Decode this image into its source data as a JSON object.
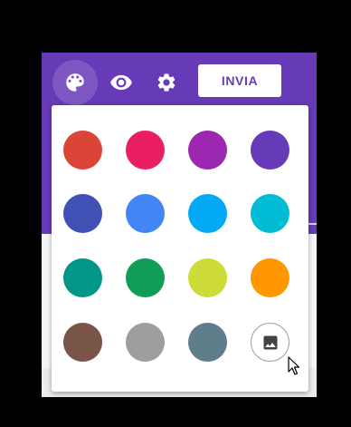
{
  "toolbar": {
    "send_label": "INVIA",
    "icons": {
      "palette": "palette-icon",
      "preview": "eye-icon",
      "settings": "gear-icon"
    }
  },
  "colors": {
    "header": "#673ab7",
    "palette_active_bg": "#7e57c2",
    "icon": "#ffffff"
  },
  "theme_colors": [
    {
      "name": "red",
      "hex": "#db4437"
    },
    {
      "name": "pink",
      "hex": "#e91e63"
    },
    {
      "name": "purple",
      "hex": "#9c27b0"
    },
    {
      "name": "deep-purple",
      "hex": "#673ab7"
    },
    {
      "name": "indigo",
      "hex": "#3f51b5"
    },
    {
      "name": "blue",
      "hex": "#4285f4"
    },
    {
      "name": "light-blue",
      "hex": "#03a9f4"
    },
    {
      "name": "cyan",
      "hex": "#00bcd4"
    },
    {
      "name": "teal",
      "hex": "#009688"
    },
    {
      "name": "green",
      "hex": "#0f9d58"
    },
    {
      "name": "lime",
      "hex": "#cddc39"
    },
    {
      "name": "orange",
      "hex": "#ff9800"
    },
    {
      "name": "brown",
      "hex": "#795548"
    },
    {
      "name": "grey",
      "hex": "#9e9e9e"
    },
    {
      "name": "blue-grey",
      "hex": "#607d8b"
    }
  ],
  "upload_icon": "image-icon"
}
